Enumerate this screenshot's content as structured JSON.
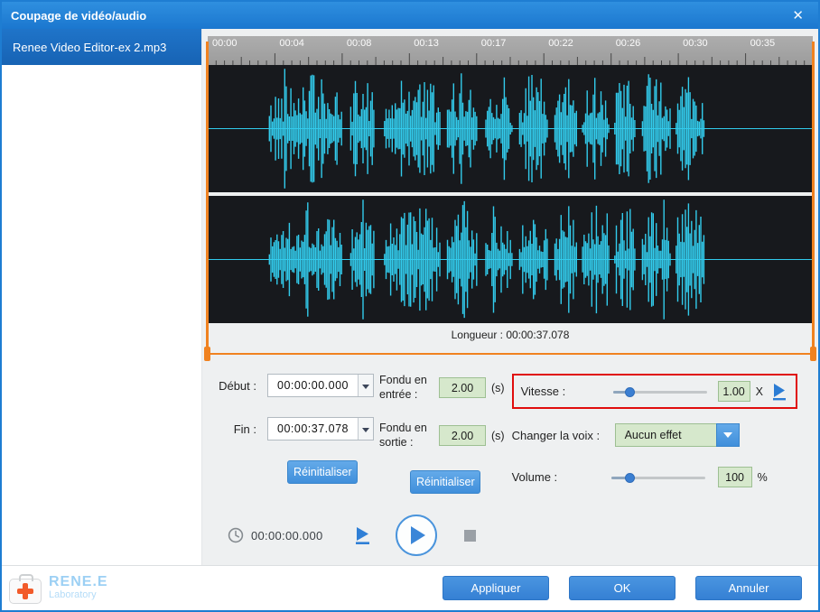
{
  "titlebar": {
    "title": "Coupage de vidéo/audio",
    "close": "✕"
  },
  "sidebar": {
    "items": [
      {
        "label": "Renee Video Editor-ex 2.mp3"
      }
    ]
  },
  "ruler": {
    "ticks": [
      "00:00",
      "00:04",
      "00:08",
      "00:13",
      "00:17",
      "00:22",
      "00:26",
      "00:30",
      "00:35"
    ]
  },
  "waveform": {
    "length_label": "Longueur : 00:00:37.078"
  },
  "controls": {
    "start": {
      "label": "Début :",
      "value": "00:00:00.000"
    },
    "end": {
      "label": "Fin :",
      "value": "00:00:37.078"
    },
    "reset_time": "Réinitialiser",
    "fade_in": {
      "label": "Fondu en entrée :",
      "value": "2.00",
      "unit": "(s)"
    },
    "fade_out": {
      "label": "Fondu en sortie :",
      "value": "2.00",
      "unit": "(s)"
    },
    "reset_fade": "Réinitialiser",
    "speed": {
      "label": "Vitesse :",
      "value": "1.00",
      "unit": "X",
      "thumb_percent": 18
    },
    "voice": {
      "label": "Changer la voix :",
      "value": "Aucun effet"
    },
    "volume": {
      "label": "Volume :",
      "value": "100",
      "unit": "%",
      "thumb_percent": 20
    }
  },
  "playbar": {
    "time": "00:00:00.000"
  },
  "footer": {
    "brand_top": "RENE.E",
    "brand_sub": "Laboratory",
    "apply": "Appliquer",
    "ok": "OK",
    "cancel": "Annuler"
  },
  "colors": {
    "titlebar_blue": "#1d7fd6",
    "button_blue": "#3b86da",
    "selection_orange": "#f08220",
    "highlight_red": "#e00d0d",
    "waveform_cyan": "#32cbec",
    "input_green": "#d6e8cc"
  }
}
